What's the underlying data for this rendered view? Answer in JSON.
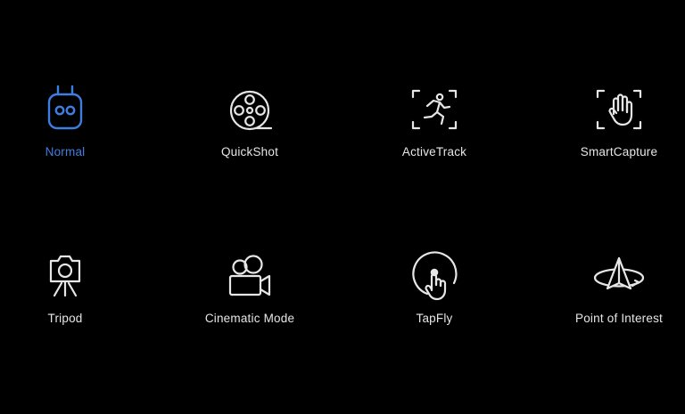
{
  "colors": {
    "background": "#000000",
    "text": "#e6e6e6",
    "icon": "#e6e6e6",
    "selected": "#3f7ee0"
  },
  "selected_mode": "normal",
  "modes": [
    {
      "id": "normal",
      "label": "Normal",
      "icon": "remote-controller-icon"
    },
    {
      "id": "quickshot",
      "label": "QuickShot",
      "icon": "film-reel-icon"
    },
    {
      "id": "activetrack",
      "label": "ActiveTrack",
      "icon": "running-person-frame-icon"
    },
    {
      "id": "smartcapture",
      "label": "SmartCapture",
      "icon": "hand-frame-icon"
    },
    {
      "id": "tripod",
      "label": "Tripod",
      "icon": "camera-tripod-icon"
    },
    {
      "id": "cinematic",
      "label": "Cinematic Mode",
      "icon": "movie-camera-icon"
    },
    {
      "id": "tapfly",
      "label": "TapFly",
      "icon": "tap-finger-icon"
    },
    {
      "id": "poi",
      "label": "Point of Interest",
      "icon": "orbit-arrow-icon"
    }
  ]
}
